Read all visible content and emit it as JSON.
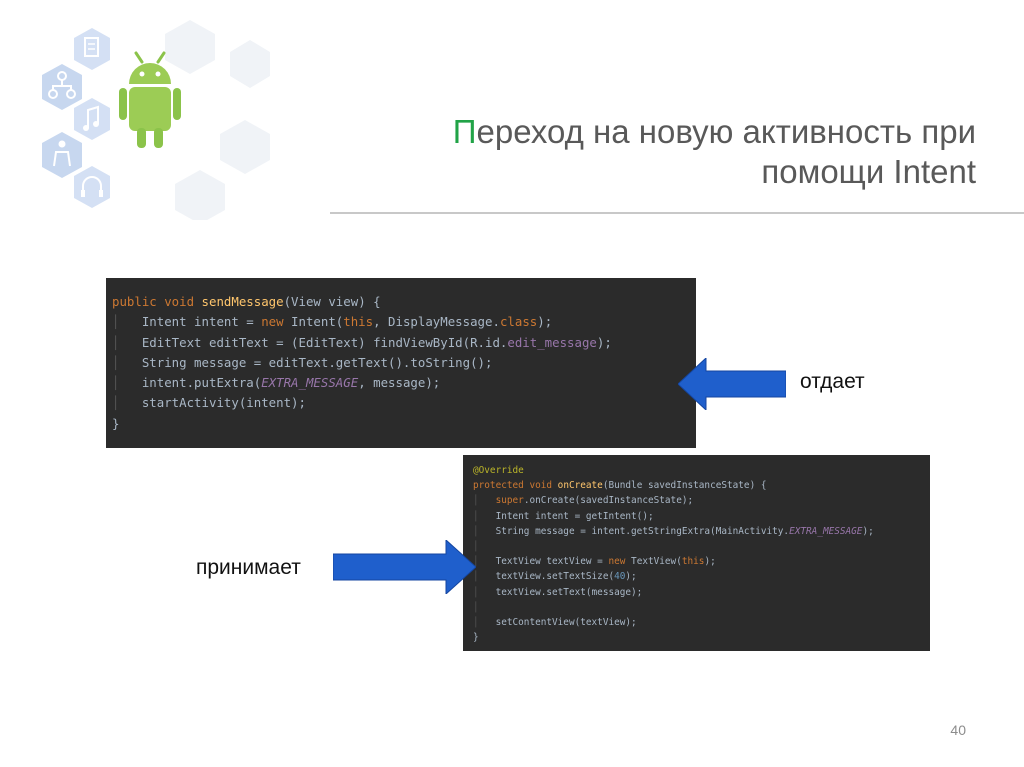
{
  "slide": {
    "title_first": "П",
    "title_line1_rest": "ереход на новую активность при",
    "title_line2": "помощи Intent",
    "label_gives": "отдает",
    "label_receives": "принимает",
    "page_number": "40"
  },
  "code1": {
    "l1": {
      "a": "public void ",
      "b": "sendMessage",
      "c": "(View view) {"
    },
    "l2": {
      "a": "Intent intent = ",
      "b": "new ",
      "c": "Intent(",
      "d": "this",
      "e": ", DisplayMessage.",
      "f": "class",
      "g": ");"
    },
    "l3": {
      "a": "EditText editText = (EditText) findViewById(R.id.",
      "b": "edit_message",
      "c": ");"
    },
    "l4": {
      "a": "String message = editText.getText().toString();"
    },
    "l5": {
      "a": "intent.putExtra(",
      "b": "EXTRA_MESSAGE",
      "c": ", message);"
    },
    "l6": {
      "a": "startActivity(intent);"
    },
    "l7": {
      "a": "}"
    }
  },
  "code2": {
    "l1": {
      "a": "@Override"
    },
    "l2": {
      "a": "protected void ",
      "b": "onCreate",
      "c": "(Bundle savedInstanceState) {"
    },
    "l3": {
      "a": "super",
      "b": ".onCreate(savedInstanceState);"
    },
    "l4": {
      "a": "Intent intent = getIntent();"
    },
    "l5": {
      "a": "String message = intent.getStringExtra(MainActivity.",
      "b": "EXTRA_MESSAGE",
      "c": ");"
    },
    "l6": {
      "a": "TextView textView = ",
      "b": "new ",
      "c": "TextView(",
      "d": "this",
      "e": ");"
    },
    "l7": {
      "a": "textView.setTextSize(",
      "b": "40",
      "c": ");"
    },
    "l8": {
      "a": "textView.setText(message);"
    },
    "l9": {
      "a": "setContentView(textView);"
    },
    "l10": {
      "a": "}"
    }
  },
  "colors": {
    "title_accent": "#21a347",
    "title_text": "#595959",
    "arrow_blue": "#1f5fcc",
    "code_background": "#2b2b2b"
  },
  "icons": [
    "android-robot-icon",
    "document-hex-icon",
    "network-hex-icon",
    "music-hex-icon",
    "people-hex-icon",
    "headphones-hex-icon"
  ]
}
